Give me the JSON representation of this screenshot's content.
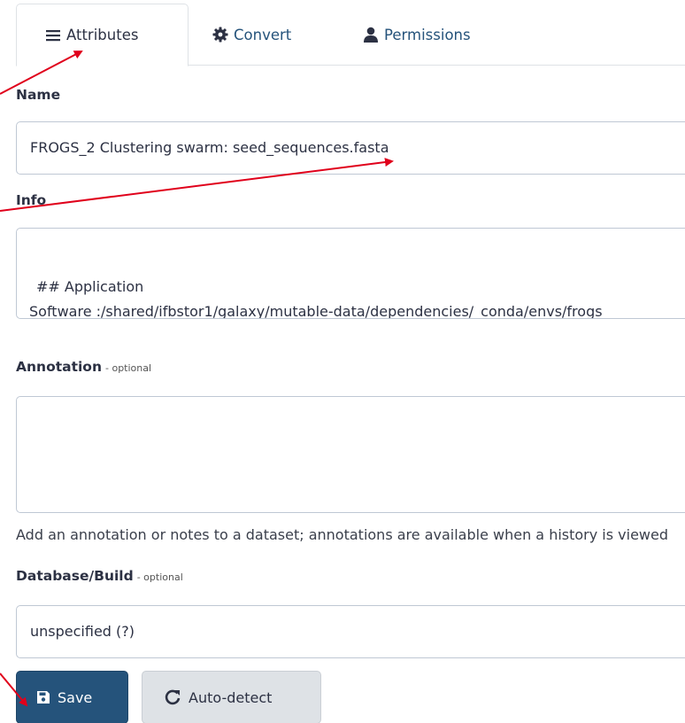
{
  "tabs": [
    {
      "label": "Attributes",
      "icon": "bars-icon",
      "active": true
    },
    {
      "label": "Convert",
      "icon": "gear-icon",
      "active": false
    },
    {
      "label": "Permissions",
      "icon": "user-icon",
      "active": false
    }
  ],
  "form": {
    "name_label": "Name",
    "name_value": "FROGS_2 Clustering swarm: seed_sequences.fasta",
    "info_label": "Info",
    "info_lines": [
      "## Application",
      "Software :/shared/ifbstor1/galaxy/mutable-data/dependencies/_conda/envs/frogs"
    ],
    "annotation_label": "Annotation",
    "optional_text": "- optional",
    "annotation_value": "",
    "annotation_help": "Add an annotation or notes to a dataset; annotations are available when a history is viewed",
    "dbkey_label": "Database/Build",
    "dbkey_value": "unspecified (?)"
  },
  "buttons": {
    "save_label": "Save",
    "autodetect_label": "Auto-detect"
  },
  "colors": {
    "primary": "#25537b",
    "secondary_bg": "#dee2e6",
    "arrow": "#e0001b"
  }
}
